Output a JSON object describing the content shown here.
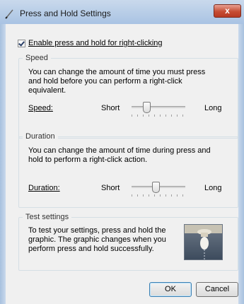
{
  "window": {
    "title": "Press and Hold Settings",
    "close_glyph": "x"
  },
  "enable_checkbox": {
    "label": "Enable press and hold for right-clicking",
    "checked": true
  },
  "speed": {
    "group_label": "Speed",
    "description": "You can change the amount of time you must press and hold before you can perform a right-click equivalent.",
    "label": "Speed:",
    "min_label": "Short",
    "max_label": "Long",
    "value_fraction": 0.25
  },
  "duration": {
    "group_label": "Duration",
    "description": "You can change the amount of time during press and hold to perform a right-click action.",
    "label": "Duration:",
    "min_label": "Short",
    "max_label": "Long",
    "value_fraction": 0.45
  },
  "test": {
    "group_label": "Test settings",
    "description": "To test your settings, press and hold the graphic. The graphic changes when you perform press and hold successfully."
  },
  "buttons": {
    "ok": "OK",
    "cancel": "Cancel"
  },
  "icons": {
    "title_icon": "pen-icon",
    "preview": "light-bulb-graphic"
  }
}
